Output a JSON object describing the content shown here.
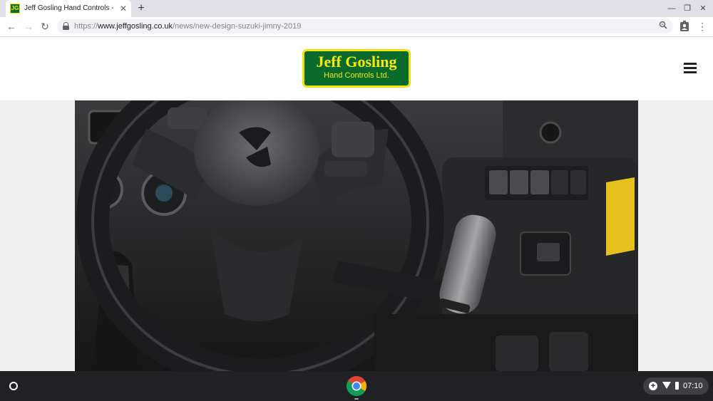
{
  "browser": {
    "tab": {
      "favicon_text": "JG",
      "title": "Jeff Gosling Hand Controls - News",
      "close_icon": "close-icon"
    },
    "new_tab_icon": "plus-icon",
    "window_controls": [
      "minimize-icon",
      "restore-icon",
      "close-icon"
    ]
  },
  "toolbar": {
    "url_scheme": "https://",
    "url_host": "www.jeffgosling.co.uk",
    "url_path": "/news/new-design-suzuki-jimny-2019",
    "icons": [
      "back-icon",
      "forward-icon",
      "reload-icon",
      "lock-icon",
      "zoom-icon",
      "account-icon",
      "menu-icon"
    ]
  },
  "site": {
    "logo_main": "Jeff Gosling",
    "logo_sub": "Hand Controls Ltd.",
    "menu_icon": "hamburger-icon",
    "colors": {
      "brand_green": "#0b6b2d",
      "brand_yellow": "#f3e600"
    },
    "hero_image": "suzuki-jimny-steering-wheel-with-hand-control"
  },
  "shelf": {
    "time": "07:10",
    "icons": [
      "launcher-icon",
      "chrome-icon",
      "add-icon",
      "wifi-icon",
      "battery-icon"
    ]
  }
}
